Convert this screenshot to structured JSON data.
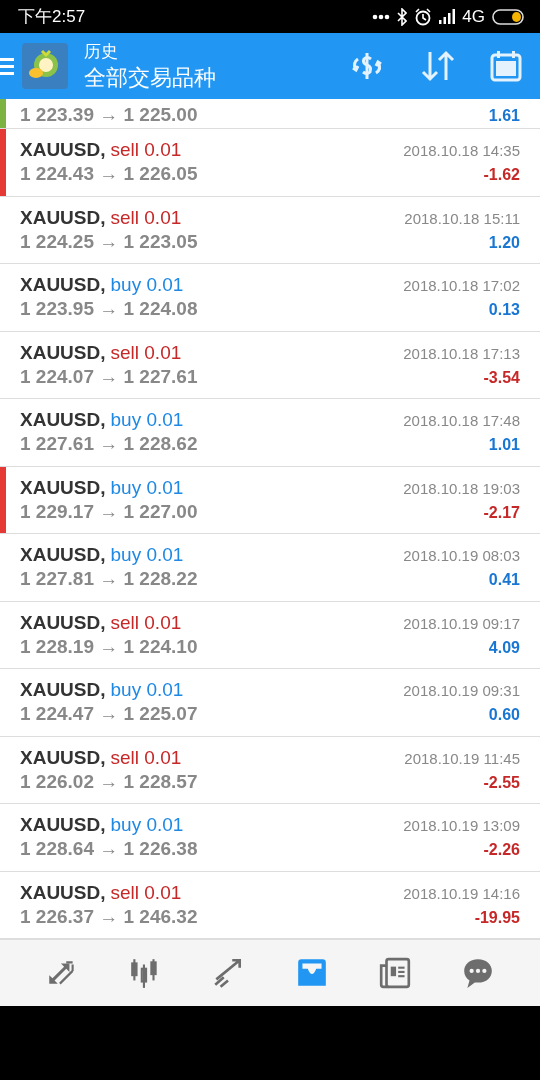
{
  "status_bar": {
    "time": "下午2:57",
    "network": "4G"
  },
  "header": {
    "title": "历史",
    "subtitle": "全部交易品种"
  },
  "partial_row": {
    "prices": "1 223.39 → 1 225.00",
    "profit": "1.61",
    "loss": false,
    "color": "#7cb342"
  },
  "deals": [
    {
      "symbol": "XAUUSD,",
      "kind": "sell",
      "side": "sell 0.01",
      "time": "2018.10.18 14:35",
      "prices": "1 224.43 → 1 226.05",
      "profit": "-1.62",
      "loss": true,
      "color": "#e53935"
    },
    {
      "symbol": "XAUUSD,",
      "kind": "sell",
      "side": "sell 0.01",
      "time": "2018.10.18 15:11",
      "prices": "1 224.25 → 1 223.05",
      "profit": "1.20",
      "loss": false
    },
    {
      "symbol": "XAUUSD,",
      "kind": "buy",
      "side": "buy 0.01",
      "time": "2018.10.18 17:02",
      "prices": "1 223.95 → 1 224.08",
      "profit": "0.13",
      "loss": false
    },
    {
      "symbol": "XAUUSD,",
      "kind": "sell",
      "side": "sell 0.01",
      "time": "2018.10.18 17:13",
      "prices": "1 224.07 → 1 227.61",
      "profit": "-3.54",
      "loss": true
    },
    {
      "symbol": "XAUUSD,",
      "kind": "buy",
      "side": "buy 0.01",
      "time": "2018.10.18 17:48",
      "prices": "1 227.61 → 1 228.62",
      "profit": "1.01",
      "loss": false
    },
    {
      "symbol": "XAUUSD,",
      "kind": "buy",
      "side": "buy 0.01",
      "time": "2018.10.18 19:03",
      "prices": "1 229.17 → 1 227.00",
      "profit": "-2.17",
      "loss": true,
      "color": "#e53935"
    },
    {
      "symbol": "XAUUSD,",
      "kind": "buy",
      "side": "buy 0.01",
      "time": "2018.10.19 08:03",
      "prices": "1 227.81 → 1 228.22",
      "profit": "0.41",
      "loss": false
    },
    {
      "symbol": "XAUUSD,",
      "kind": "sell",
      "side": "sell 0.01",
      "time": "2018.10.19 09:17",
      "prices": "1 228.19 → 1 224.10",
      "profit": "4.09",
      "loss": false
    },
    {
      "symbol": "XAUUSD,",
      "kind": "buy",
      "side": "buy 0.01",
      "time": "2018.10.19 09:31",
      "prices": "1 224.47 → 1 225.07",
      "profit": "0.60",
      "loss": false
    },
    {
      "symbol": "XAUUSD,",
      "kind": "sell",
      "side": "sell 0.01",
      "time": "2018.10.19 11:45",
      "prices": "1 226.02 → 1 228.57",
      "profit": "-2.55",
      "loss": true
    },
    {
      "symbol": "XAUUSD,",
      "kind": "buy",
      "side": "buy 0.01",
      "time": "2018.10.19 13:09",
      "prices": "1 228.64 → 1 226.38",
      "profit": "-2.26",
      "loss": true
    },
    {
      "symbol": "XAUUSD,",
      "kind": "sell",
      "side": "sell 0.01",
      "time": "2018.10.19 14:16",
      "prices": "1 226.37 → 1 246.32",
      "profit": "-19.95",
      "loss": true
    }
  ],
  "nav": [
    {
      "kind": "quotes",
      "selected": false
    },
    {
      "kind": "chart",
      "selected": false
    },
    {
      "kind": "trade",
      "selected": false
    },
    {
      "kind": "history",
      "selected": true
    },
    {
      "kind": "news",
      "selected": false
    },
    {
      "kind": "chat",
      "selected": false
    }
  ]
}
